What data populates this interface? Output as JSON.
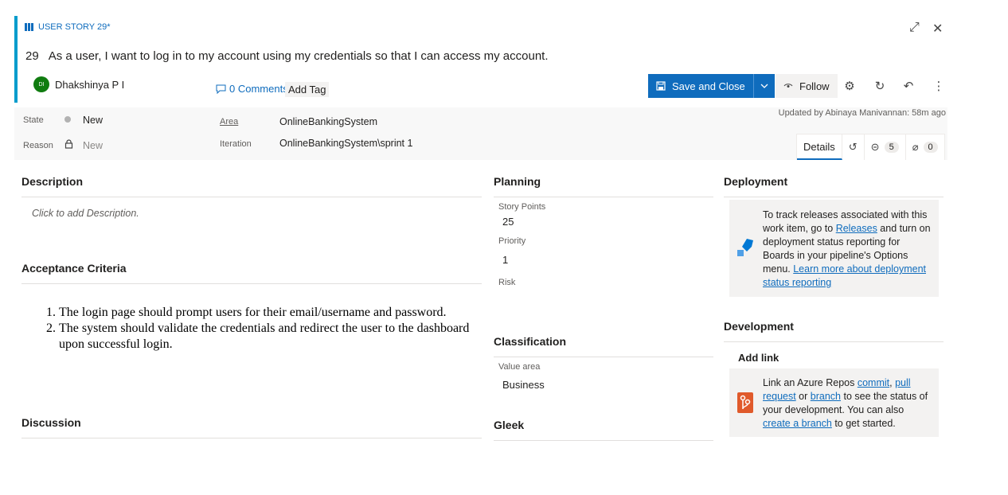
{
  "work_item": {
    "type_label": "USER STORY 29*",
    "id": "29",
    "title": "As a user, I want to log in to my account using my credentials so that I can access my account."
  },
  "window_controls": {
    "expand_icon": "expand-icon",
    "close_icon": "close-icon"
  },
  "assignee": {
    "initials": "DI",
    "name": "Dhakshinya P I"
  },
  "comments": {
    "label": "0 Comments"
  },
  "tags": {
    "add_label": "Add Tag"
  },
  "toolbar": {
    "save_label": "Save and Close",
    "follow_label": "Follow"
  },
  "status": {
    "updated_text": "Updated by Abinaya Manivannan: 58m ago"
  },
  "fields": {
    "state_label": "State",
    "state_value": "New",
    "reason_label": "Reason",
    "reason_value": "New",
    "area_label": "Area",
    "area_value": "OnlineBankingSystem",
    "iteration_label": "Iteration",
    "iteration_value": "OnlineBankingSystem\\sprint 1"
  },
  "tabs": {
    "details_label": "Details",
    "links_count": "5",
    "attachments_count": "0"
  },
  "description": {
    "title": "Description",
    "placeholder": "Click to add Description."
  },
  "acceptance": {
    "title": "Acceptance Criteria",
    "items": [
      "The login page should prompt users for their email/username and password.",
      "The system should validate the credentials and redirect the user to the dashboard upon successful login."
    ]
  },
  "discussion": {
    "title": "Discussion"
  },
  "planning": {
    "title": "Planning",
    "story_points_label": "Story Points",
    "story_points_value": "25",
    "priority_label": "Priority",
    "priority_value": "1",
    "risk_label": "Risk"
  },
  "classification": {
    "title": "Classification",
    "value_area_label": "Value area",
    "value_area_value": "Business"
  },
  "gleek": {
    "title": "Gleek"
  },
  "deployment": {
    "title": "Deployment",
    "text_1": "To track releases associated with this work item, go to ",
    "link_releases": "Releases",
    "text_2": " and turn on deployment status reporting for Boards in your pipeline's Options menu. ",
    "link_learn_more": "Learn more about deployment status reporting"
  },
  "development": {
    "title": "Development",
    "add_link_label": "Add link",
    "text_1": "Link an Azure Repos ",
    "link_commit": "commit",
    "sep_1": ", ",
    "link_pull_request": "pull request",
    "text_2": " or ",
    "link_branch": "branch",
    "text_3": " to see the status of your development. You can also ",
    "link_create_branch": "create a branch",
    "text_4": " to get started."
  },
  "colors": {
    "accent_stripe": "#009ccc",
    "primary_button": "#0f6cbd",
    "avatar": "#107c10",
    "link": "#0f6cbd"
  }
}
